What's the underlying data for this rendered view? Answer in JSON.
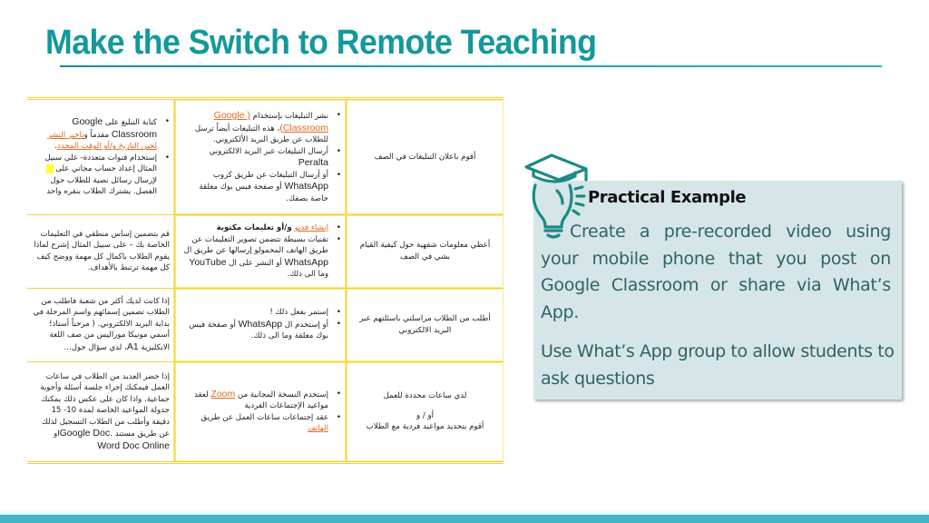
{
  "slide": {
    "title": "Make the Switch to Remote Teaching"
  },
  "table": {
    "rows": [
      {
        "col3": "أقوم باعلان التبليغات في الصف",
        "col2": {
          "b1_pre": "نشر التبليغات بإستخدام ",
          "b1_link": "( Google Classroom)",
          "b1_post": "، هذه التبليغات أيضاً ترسل للطلاب عن طريق البريد الألكتروني.",
          "b2_pre": "أرسال التبليغات عبر البريد الالكتروني ",
          "b2_latin": "Peralta",
          "b3_pre": "أو أرسال التبليغات عن طريق كروب ",
          "b3_latin": "WhatsApp",
          "b3_post": " أو صفحة فيس بوك مغلقة خاصة بصفك."
        },
        "col1": {
          "b1_pre": "كتابة التبليغ على ",
          "b1_latin": "Google Classroom",
          "b1_mid": " مقدماً و",
          "b1_link": "تاخير النشر لحين التاريخ و/أو الوقت المحدد",
          "b1_post": ".",
          "b2_pre": "إستخدام قنوات متعددة- على سبيل المثال إعداد حساب مجاني على ",
          "b2_post": " لإرسال رسائل نصية للطلاب حول الفصل. يشترك الطلاب بنقره واحد"
        }
      },
      {
        "col3": "أعطي معلومات شفهية حول كيفية القيام بشي في الصف",
        "col2": {
          "b1_link": "إنشاء فديو",
          "b1_post": " و/أو تعليمات مكتوبة",
          "b2_pre": "تقنيات بسيطة تتضمن تصوير التعليمات عن طريق الهاتف المحمولو إرسالها عن طريق ال ",
          "b2_latin1": "WhatsApp",
          "b2_mid": " أو النشر على ال ",
          "b2_latin2": "YouTube",
          "b2_post": " وما الى ذلك."
        },
        "col1": "قم بتضمين إساس منطقي في التعليمات الخاصة بك – على سبيل المثال إشرح لماذا يقوم الطلاب باكمال كل مهمة ووضح كيف كل مهمة ترتبط بالأهداف."
      },
      {
        "col3": "أطلب من الطلاب مراسلتي باسئلتهم عبر البريد الالكتروني",
        "col2": {
          "b1": "إستمر بفعل ذلك !",
          "b2_pre": "أو إستخدم ال ",
          "b2_latin": "WhatsApp",
          "b2_post": " أو صفحة فيس بوك مغلقة وما الى ذلك."
        },
        "col1_pre": "إذا كانت لديك أكثر من شعبة فاطلب من الطلاب تضمين إسمائهم واسم المرحلة في بداية البريد الالكتروني. ( مرحباً أستاذ! أسمي مونيكا موراليس من صف اللغة الانكليزية ",
        "col1_latin": "A1",
        "col1_post": "، لدي سؤال حول..."
      },
      {
        "col3_line1": "لدي ساعات محددة للعمل",
        "col3_line2": "أو / و",
        "col3_line3": "أقوم بتحديد مواعيد فردية مع الطلاب",
        "col2": {
          "b1_pre": "إستخدم النسخة المجانية من ",
          "b1_link": "Zoom",
          "b1_post": " لعقد مواعيد الإجتماعات الفردية",
          "b2_pre": "عقد إجتماعات ساعات العمل عن طريق ",
          "b2_link": "الهاتف"
        },
        "col1_pre": "إذا حضر العديد من الطلاب في ساعات العمل فيمكنك إجراء جلسة أسئلة وأجوبة جماعية. واذا كان على عكس ذلك يمكنك جدولة المواعيد الخاصة لمدة 10- 15 دقيقة وأطلب من الطلاب التسجيل لذلك عن طريق مستند ",
        "col1_latin": ".Google Doc",
        "col1_mid": "او ",
        "col1_latin2": "Word Doc Online"
      }
    ]
  },
  "card": {
    "icon": "lightbulb-graduation-cap-icon",
    "heading": "Practical Example",
    "paragraph1": "Create a pre-recorded video using your mobile phone that you post on Google Classroom or share via What’s App.",
    "paragraph2": "Use What’s App group to allow students to ask questions"
  },
  "colors": {
    "title": "#13999b",
    "table_border": "#f5d33b",
    "link": "#e06a24",
    "card_bg": "#d6e6e8",
    "card_text": "#2f6264",
    "icon": "#1b8a87",
    "bottom_bar": "#45b5c6"
  }
}
